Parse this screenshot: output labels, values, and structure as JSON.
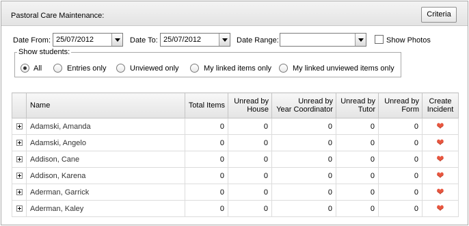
{
  "header": {
    "title": "Pastoral Care Maintenance:",
    "criteria_label": "Criteria"
  },
  "filters": {
    "date_from_label": "Date From:",
    "date_from_value": "25/07/2012",
    "date_to_label": "Date To:",
    "date_to_value": "25/07/2012",
    "date_range_label": "Date Range:",
    "date_range_value": "",
    "show_photos_label": "Show Photos",
    "show_photos_checked": false
  },
  "show_students": {
    "legend": "Show students:",
    "options": [
      {
        "label": "All",
        "checked": true
      },
      {
        "label": "Entries only",
        "checked": false
      },
      {
        "label": "Unviewed only",
        "checked": false
      },
      {
        "label": "My linked items only",
        "checked": false
      },
      {
        "label": "My linked unviewed items only",
        "checked": false
      }
    ]
  },
  "table": {
    "columns": {
      "name": "Name",
      "total": "Total Items",
      "house_1": "Unread by",
      "house_2": "House",
      "year_1": "Unread by",
      "year_2": "Year Coordinator",
      "tutor_1": "Unread by",
      "tutor_2": "Tutor",
      "form_1": "Unread by",
      "form_2": "Form",
      "incident_1": "Create",
      "incident_2": "Incident"
    },
    "rows": [
      {
        "name": "Adamski, Amanda",
        "total": "0",
        "house": "0",
        "year": "0",
        "tutor": "0",
        "form": "0"
      },
      {
        "name": "Adamski, Angelo",
        "total": "0",
        "house": "0",
        "year": "0",
        "tutor": "0",
        "form": "0"
      },
      {
        "name": "Addison, Cane",
        "total": "0",
        "house": "0",
        "year": "0",
        "tutor": "0",
        "form": "0"
      },
      {
        "name": "Addison, Karena",
        "total": "0",
        "house": "0",
        "year": "0",
        "tutor": "0",
        "form": "0"
      },
      {
        "name": "Aderman, Garrick",
        "total": "0",
        "house": "0",
        "year": "0",
        "tutor": "0",
        "form": "0"
      },
      {
        "name": "Aderman, Kaley",
        "total": "0",
        "house": "0",
        "year": "0",
        "tutor": "0",
        "form": "0"
      }
    ],
    "create_incident_icon": "heart-icon",
    "expand_icon": "plus-expand-icon"
  },
  "colors": {
    "heart": "#e8563f"
  }
}
